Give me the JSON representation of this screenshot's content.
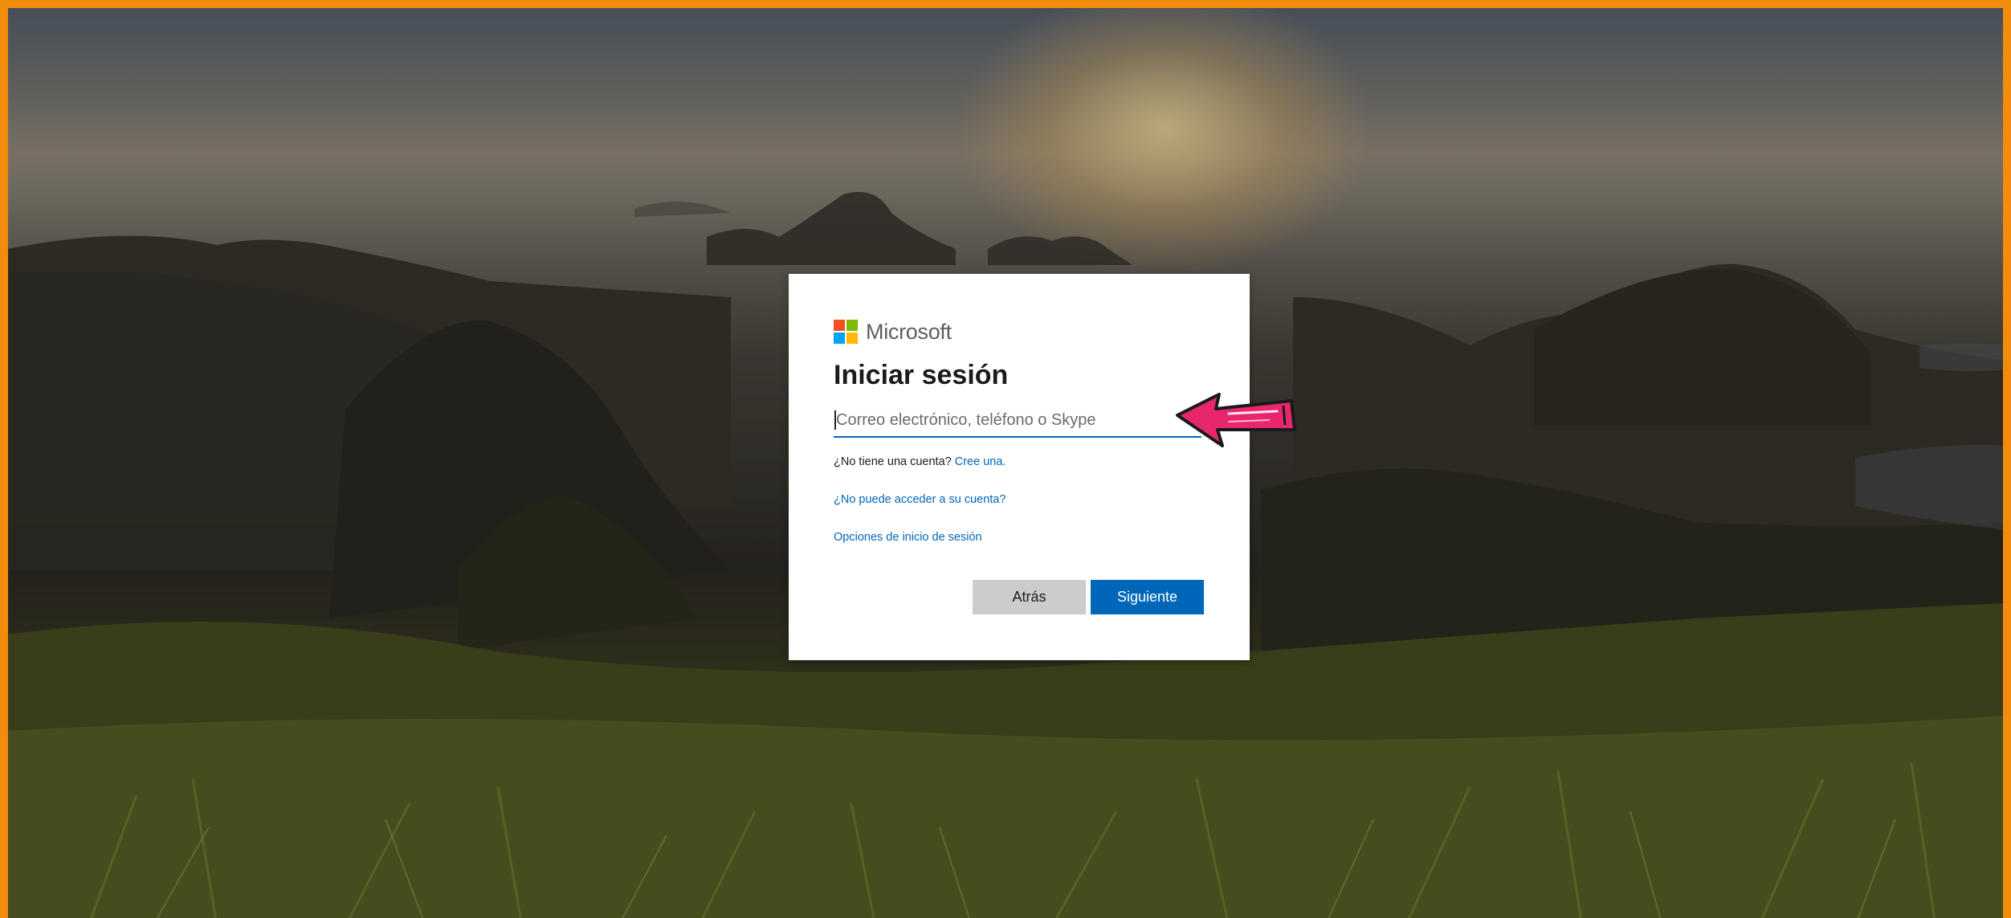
{
  "brand": {
    "name": "Microsoft",
    "logo_colors": [
      "#f25022",
      "#7fba00",
      "#00a4ef",
      "#ffb900"
    ]
  },
  "signin": {
    "title": "Iniciar sesión",
    "input_placeholder": "Correo electrónico, teléfono o Skype",
    "input_value": "",
    "no_account_text": "¿No tiene una cuenta?",
    "create_link": "Cree una.",
    "cant_access_link": "¿No puede acceder a su cuenta?",
    "signin_options_link": "Opciones de inicio de sesión"
  },
  "buttons": {
    "back_label": "Atrás",
    "next_label": "Siguiente"
  },
  "colors": {
    "accent": "#0067b8",
    "frame": "#f28c0f",
    "annotation_arrow": "#e8266d"
  },
  "icons": {
    "annotation": "left-arrow-annotation-icon"
  }
}
